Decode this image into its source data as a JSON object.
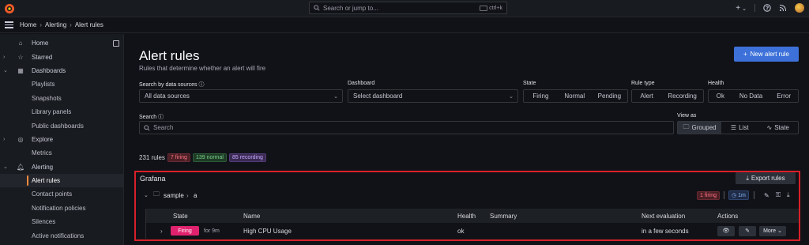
{
  "topbar": {
    "search_placeholder": "Search or jump to...",
    "shortcut": "ctrl+k",
    "add_symbol": "+",
    "add_caret": "⌄"
  },
  "breadcrumb": [
    "Home",
    "Alerting",
    "Alert rules"
  ],
  "sidebar": {
    "items": [
      {
        "label": "Home",
        "icon": "home-icon",
        "chevron": ""
      },
      {
        "label": "Starred",
        "icon": "star-icon",
        "chevron": "›"
      },
      {
        "label": "Dashboards",
        "icon": "dashboards-icon",
        "chevron": "⌄"
      },
      {
        "label": "Playlists",
        "sub": true
      },
      {
        "label": "Snapshots",
        "sub": true
      },
      {
        "label": "Library panels",
        "sub": true
      },
      {
        "label": "Public dashboards",
        "sub": true
      },
      {
        "label": "Explore",
        "icon": "compass-icon",
        "chevron": "›"
      },
      {
        "label": "Metrics",
        "sub": true
      },
      {
        "label": "Alerting",
        "icon": "bell-icon",
        "chevron": "⌄"
      },
      {
        "label": "Alert rules",
        "sub": true,
        "active": true
      },
      {
        "label": "Contact points",
        "sub": true
      },
      {
        "label": "Notification policies",
        "sub": true
      },
      {
        "label": "Silences",
        "sub": true
      },
      {
        "label": "Active notifications",
        "sub": true
      }
    ]
  },
  "page": {
    "title": "Alert rules",
    "subtitle": "Rules that determine whether an alert will fire",
    "new_button": "New alert rule"
  },
  "filters": {
    "datasource_label": "Search by data sources",
    "datasource_value": "All data sources",
    "dashboard_label": "Dashboard",
    "dashboard_value": "Select dashboard",
    "state_label": "State",
    "state_options": [
      "Firing",
      "Normal",
      "Pending"
    ],
    "ruletype_label": "Rule type",
    "ruletype_options": [
      "Alert",
      "Recording"
    ],
    "health_label": "Health",
    "health_options": [
      "Ok",
      "No Data",
      "Error"
    ],
    "search_label": "Search",
    "search_placeholder": "Search",
    "viewas_label": "View as",
    "viewas_options": [
      "Grouped",
      "List",
      "State"
    ],
    "viewas_selected": "Grouped"
  },
  "summary": {
    "total": "231 rules",
    "firing": "7 firing",
    "normal": "139 normal",
    "recording": "85 recording"
  },
  "grafana": {
    "title": "Grafana",
    "export_button": "Export rules",
    "folder": "sample",
    "group": "a",
    "firing_count": "1 firing",
    "interval": "1m",
    "table": {
      "headers": [
        "State",
        "Name",
        "Health",
        "Summary",
        "Next evaluation",
        "Actions"
      ],
      "rows": [
        {
          "state": "Firing",
          "duration": "for 9m",
          "name": "High CPU Usage",
          "health": "ok",
          "summary": "",
          "next_eval": "in a few seconds",
          "more": "More"
        }
      ]
    }
  },
  "colors": {
    "accent": "#3d71d9",
    "firing": "#e0226e",
    "highlight_border": "#d8202a",
    "active_marker": "#ff8a3d"
  }
}
